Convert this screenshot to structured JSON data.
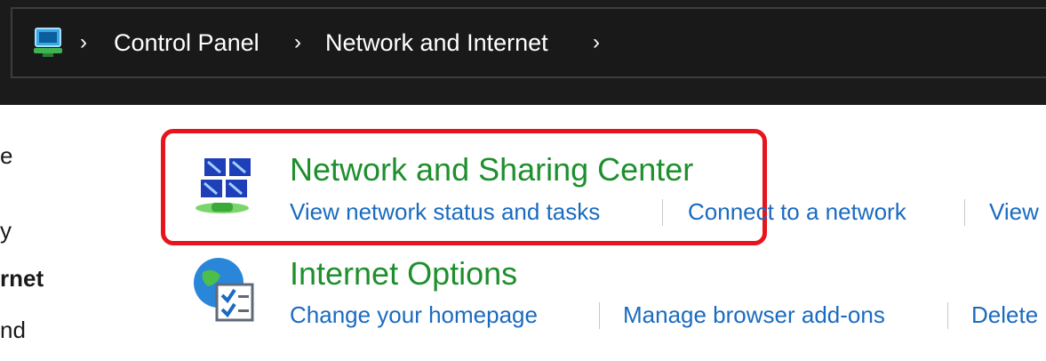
{
  "breadcrumb": {
    "icon": "control-panel-icon",
    "items": [
      "Control Panel",
      "Network and Internet"
    ],
    "separator": "›"
  },
  "sidebar": {
    "fragments": [
      "e",
      "y",
      "rnet",
      "nd"
    ]
  },
  "categories": [
    {
      "title": "Network and Sharing Center",
      "icon": "network-sharing-icon",
      "links": [
        "View network status and tasks",
        "Connect to a network",
        "View"
      ]
    },
    {
      "title": "Internet Options",
      "icon": "internet-options-icon",
      "links": [
        "Change your homepage",
        "Manage browser add-ons",
        "Delete"
      ]
    }
  ],
  "colors": {
    "title_green": "#1e8f2d",
    "link_blue": "#1a6bc0",
    "highlight_red": "#e8141b",
    "topbar_bg": "#1b1b1b"
  }
}
